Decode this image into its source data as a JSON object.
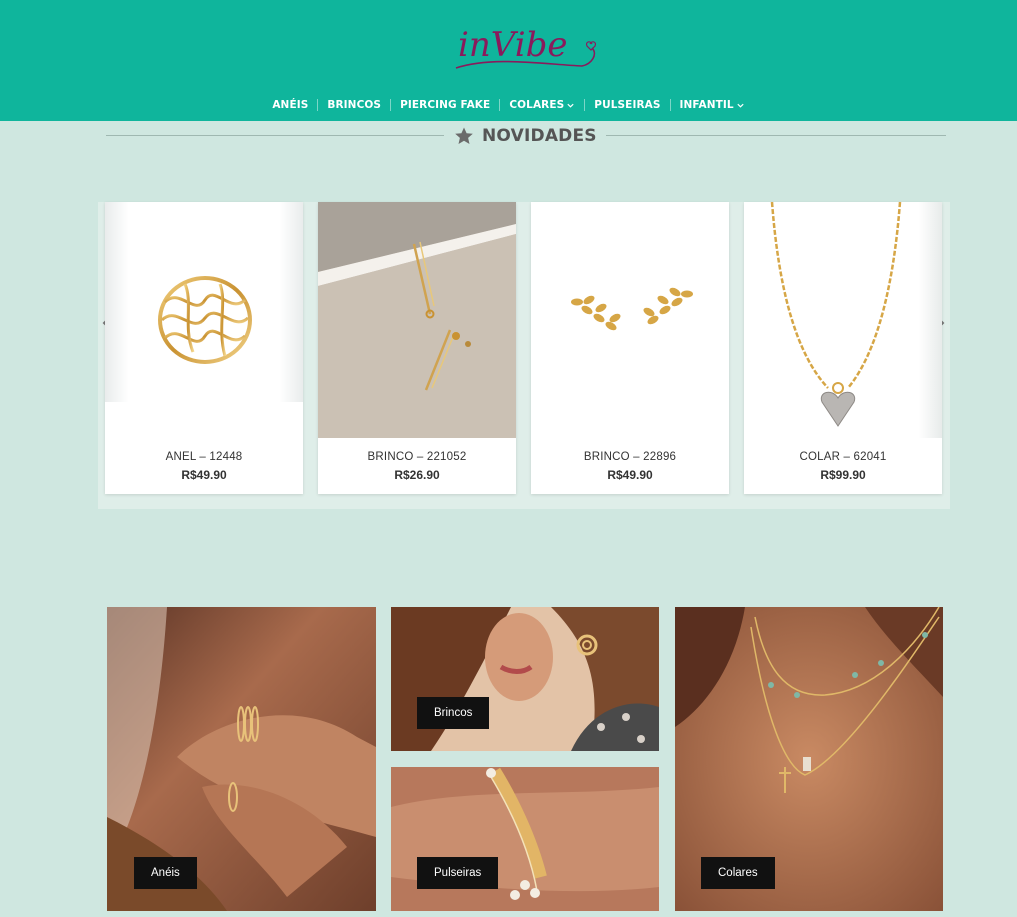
{
  "brand": {
    "logo_text": "inVibe"
  },
  "nav": {
    "items": [
      {
        "label": "ANÉIS"
      },
      {
        "label": "BRINCOS"
      },
      {
        "label": "PIERCING FAKE"
      },
      {
        "label": "COLARES"
      },
      {
        "label": "PULSEIRAS"
      },
      {
        "label": "INFANTIL"
      }
    ]
  },
  "section": {
    "title": "NOVIDADES"
  },
  "products": [
    {
      "name": "ANEL – 12448",
      "price": "R$49.90"
    },
    {
      "name": "BRINCO – 221052",
      "price": "R$26.90"
    },
    {
      "name": "BRINCO – 22896",
      "price": "R$49.90"
    },
    {
      "name": "COLAR – 62041",
      "price": "R$99.90"
    }
  ],
  "categories": [
    {
      "label": "Anéis"
    },
    {
      "label": "Brincos"
    },
    {
      "label": "Pulseiras"
    },
    {
      "label": "Colares"
    }
  ],
  "colors": {
    "header": "#0fb59c",
    "background": "#cfe7e0",
    "logo": "#8a1a5c"
  }
}
